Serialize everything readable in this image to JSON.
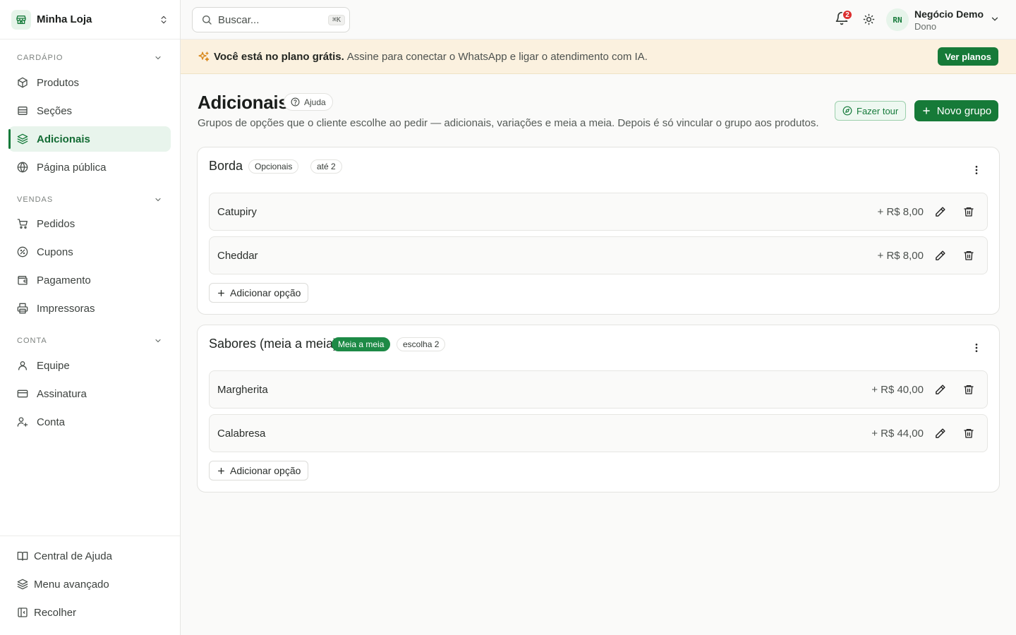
{
  "store": {
    "name": "Minha Loja",
    "logo_icon": "store-icon"
  },
  "sidebar": {
    "sections": [
      {
        "title": "CARDÁPIO",
        "items": [
          {
            "label": "Produtos",
            "icon": "package-icon"
          },
          {
            "label": "Seções",
            "icon": "list-icon"
          },
          {
            "label": "Adicionais",
            "icon": "layers-icon",
            "active": true
          },
          {
            "label": "Página pública",
            "icon": "globe-icon"
          }
        ]
      },
      {
        "title": "VENDAS",
        "items": [
          {
            "label": "Pedidos",
            "icon": "cart-icon"
          },
          {
            "label": "Cupons",
            "icon": "coupon-icon"
          },
          {
            "label": "Pagamento",
            "icon": "wallet-icon"
          },
          {
            "label": "Impressoras",
            "icon": "printer-icon"
          }
        ]
      },
      {
        "title": "CONTA",
        "items": [
          {
            "label": "Equipe",
            "icon": "user-icon"
          },
          {
            "label": "Assinatura",
            "icon": "credit-card-icon"
          },
          {
            "label": "Conta",
            "icon": "user-settings-icon"
          }
        ]
      }
    ],
    "footer": [
      {
        "label": "Central de Ajuda",
        "icon": "book-icon"
      },
      {
        "label": "Menu avançado",
        "icon": "layers-icon"
      },
      {
        "label": "Recolher",
        "icon": "collapse-icon"
      }
    ]
  },
  "topbar": {
    "search_placeholder": "Buscar...",
    "search_shortcut": "⌘K",
    "notifications_count": "2",
    "user": {
      "initials": "RN",
      "name": "Negócio Demo",
      "role": "Dono"
    }
  },
  "banner": {
    "strong": "Você está no plano grátis.",
    "text": "Assine para conectar o WhatsApp e ligar o atendimento com IA.",
    "button": "Ver planos"
  },
  "page": {
    "title": "Adicionais",
    "help_label": "Ajuda",
    "subtitle": "Grupos de opções que o cliente escolhe ao pedir — adicionais, variações e meia a meia. Depois é só vincular o grupo aos produtos.",
    "tour_button": "Fazer tour",
    "new_button": "Novo grupo"
  },
  "groups": [
    {
      "title": "Borda",
      "chips": [
        {
          "label": "Opcionais",
          "style": "outline"
        },
        {
          "label": "até 2",
          "style": "outline"
        }
      ],
      "options": [
        {
          "name": "Catupiry",
          "price": "+ R$ 8,00"
        },
        {
          "name": "Cheddar",
          "price": "+ R$ 8,00"
        }
      ],
      "add_label": "Adicionar opção"
    },
    {
      "title": "Sabores (meia a meia)",
      "chips": [
        {
          "label": "Meia a meia",
          "style": "green"
        },
        {
          "label": "escolha 2",
          "style": "outline"
        }
      ],
      "options": [
        {
          "name": "Margherita",
          "price": "+ R$ 40,00"
        },
        {
          "name": "Calabresa",
          "price": "+ R$ 44,00"
        }
      ],
      "add_label": "Adicionar opção"
    }
  ],
  "colors": {
    "brand": "#167a38",
    "active_bg": "#e8f4ec",
    "banner_bg": "#fbf1df",
    "badge": "#dc2f2f"
  }
}
